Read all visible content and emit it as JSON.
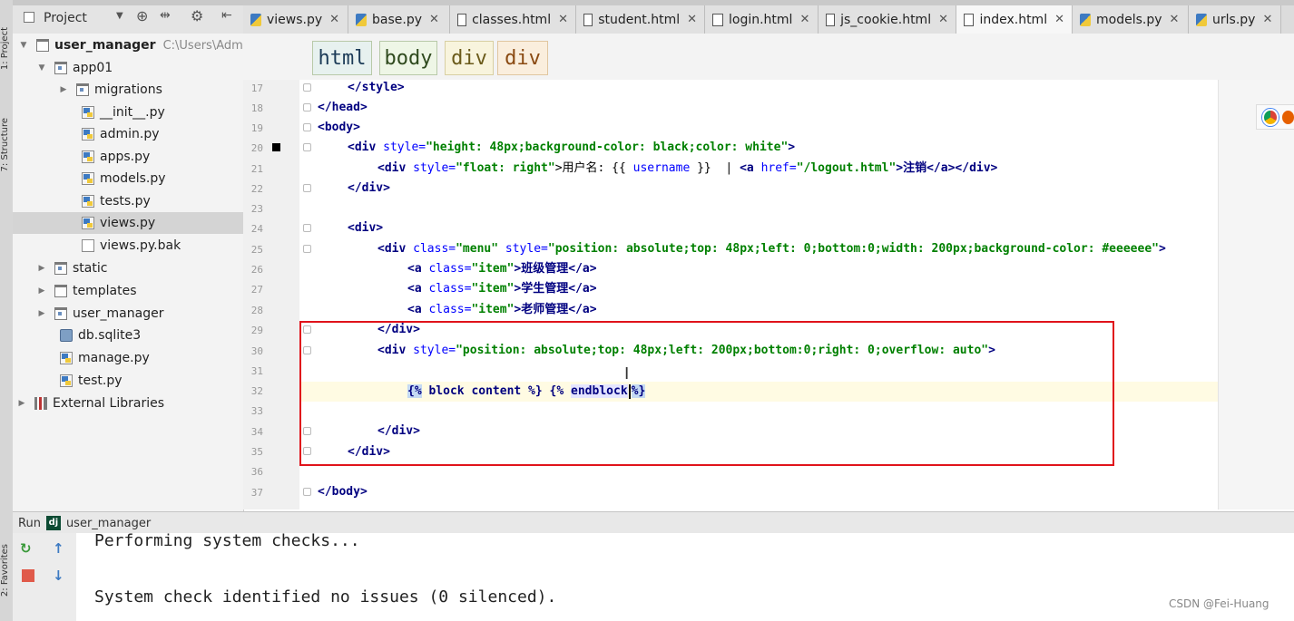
{
  "left_strip": {
    "project_label": "1: Project",
    "structure_label": "7: Structure",
    "favorites_label": "2: Favorites"
  },
  "project_panel": {
    "title": "Project",
    "dropdown_icon": "chevron-down-icon",
    "root": {
      "name": "user_manager",
      "path": "C:\\Users\\Adm"
    },
    "items": [
      {
        "label": "app01"
      },
      {
        "label": "migrations"
      },
      {
        "label": "__init__.py"
      },
      {
        "label": "admin.py"
      },
      {
        "label": "apps.py"
      },
      {
        "label": "models.py"
      },
      {
        "label": "tests.py"
      },
      {
        "label": "views.py"
      },
      {
        "label": "views.py.bak"
      },
      {
        "label": "static"
      },
      {
        "label": "templates"
      },
      {
        "label": "user_manager"
      },
      {
        "label": "db.sqlite3"
      },
      {
        "label": "manage.py"
      },
      {
        "label": "test.py"
      },
      {
        "label": "External Libraries"
      }
    ]
  },
  "tabs": [
    {
      "label": "views.py"
    },
    {
      "label": "base.py"
    },
    {
      "label": "classes.html"
    },
    {
      "label": "student.html"
    },
    {
      "label": "login.html"
    },
    {
      "label": "js_cookie.html"
    },
    {
      "label": "index.html"
    },
    {
      "label": "models.py"
    },
    {
      "label": "urls.py"
    }
  ],
  "active_tab": "index.html",
  "breadcrumb": [
    "html",
    "body",
    "div",
    "div"
  ],
  "editor": {
    "line_numbers": [
      "17",
      "18",
      "19",
      "20",
      "21",
      "22",
      "23",
      "24",
      "25",
      "26",
      "27",
      "28",
      "29",
      "30",
      "31",
      "32",
      "33",
      "34",
      "35",
      "36",
      "37"
    ],
    "current_line": "32",
    "lines": {
      "l17": "</style>",
      "l18": "</head>",
      "l19": "<body>",
      "l20_open": "<div ",
      "l20_attr": "style=",
      "l20_val": "\"height: 48px;background-color: black;color: white\"",
      "l20_close": ">",
      "l21_open": "<div ",
      "l21_attr": "style=",
      "l21_val": "\"float: right\"",
      "l21_text1": ">用户名: {{ ",
      "l21_var": "username",
      "l21_text2": " }}  | ",
      "l21_a": "<a ",
      "l21_href": "href=",
      "l21_hval": "\"/logout.html\"",
      "l21_text3": ">注销</a></div>",
      "l22": "</div>",
      "l24": "<div>",
      "l25_open": "<div ",
      "l25_attr1": "class=",
      "l25_val1": "\"menu\"",
      "l25_attr2": " style=",
      "l25_val2": "\"position: absolute;top: 48px;left: 0;bottom:0;width: 200px;background-color: #eeeeee\"",
      "l25_close": ">",
      "l26_open": "<a ",
      "l26_attr": "class=",
      "l26_val": "\"item\"",
      "l26_text": ">班级管理</a>",
      "l27_open": "<a ",
      "l27_attr": "class=",
      "l27_val": "\"item\"",
      "l27_text": ">学生管理</a>",
      "l28_open": "<a ",
      "l28_attr": "class=",
      "l28_val": "\"item\"",
      "l28_text": ">老师管理</a>",
      "l29": "</div>",
      "l30_open": "<div ",
      "l30_attr": "style=",
      "l30_val": "\"position: absolute;top: 48px;left: 200px;bottom:0;right: 0;overflow: auto\"",
      "l30_close": ">",
      "l32_a": "{%",
      "l32_b": " block content %} {% ",
      "l32_c": "endblock",
      "l32_d": "%}",
      "l34": "</div>",
      "l35": "</div>",
      "l37": "</body>"
    }
  },
  "run_panel": {
    "label": "Run",
    "config": "user_manager",
    "console": [
      "Performing system checks...",
      "",
      "System check identified no issues (0 silenced)."
    ]
  },
  "watermark": "CSDN @Fei-Huang"
}
